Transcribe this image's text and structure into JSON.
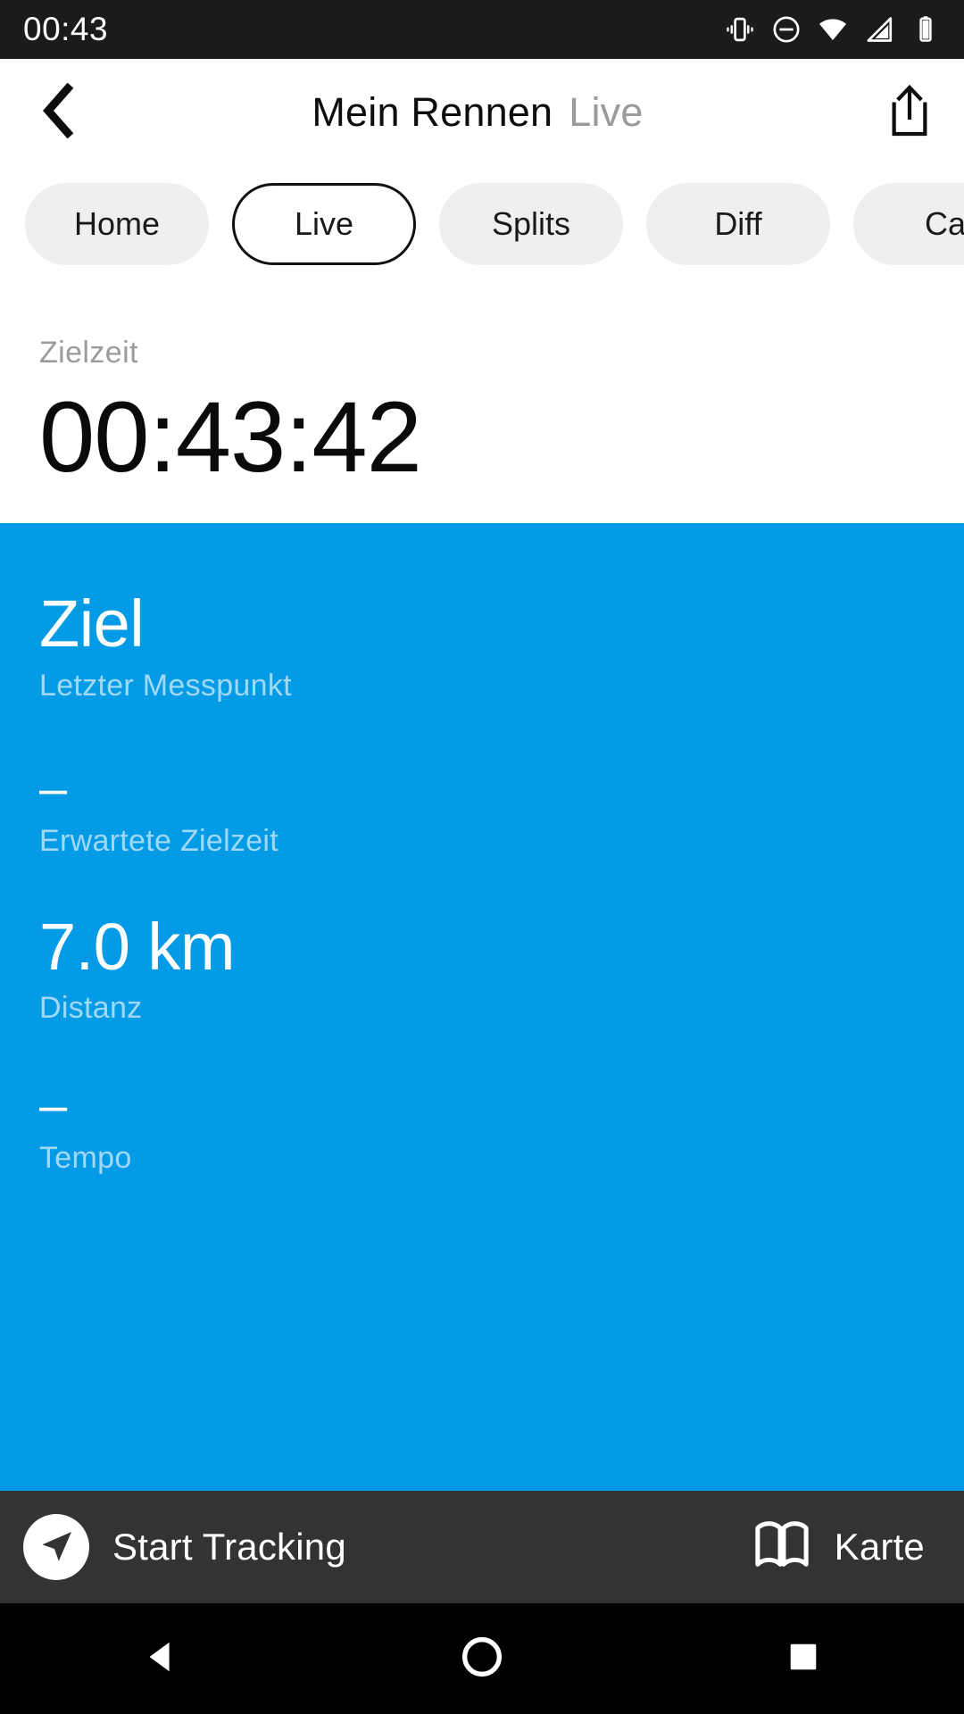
{
  "statusbar": {
    "clock": "00:43",
    "icons": [
      {
        "name": "vibrate-icon"
      },
      {
        "name": "do-not-disturb-icon"
      },
      {
        "name": "wifi-icon"
      },
      {
        "name": "cellular-signal-icon"
      },
      {
        "name": "battery-icon"
      }
    ]
  },
  "header": {
    "back_icon": "chevron-left-icon",
    "title": "Mein Rennen",
    "subtitle": "Live",
    "share_icon": "share-icon"
  },
  "tabs": {
    "items": [
      {
        "label": "Home",
        "selected": false
      },
      {
        "label": "Live",
        "selected": true
      },
      {
        "label": "Splits",
        "selected": false
      },
      {
        "label": "Diff",
        "selected": false
      },
      {
        "label": "Ca",
        "selected": false
      }
    ]
  },
  "summary": {
    "label": "Zielzeit",
    "value": "00:43:42"
  },
  "card": {
    "accent_color": "#039BE5",
    "metrics": [
      {
        "value": "Ziel",
        "label": "Letzter Messpunkt",
        "size": "big"
      },
      {
        "value": "–",
        "label": "Erwartete Zielzeit",
        "size": "dash"
      },
      {
        "value": "7.0 km",
        "label": "Distanz",
        "size": "big"
      },
      {
        "value": "–",
        "label": "Tempo",
        "size": "dash"
      }
    ]
  },
  "toolbar": {
    "tracking_icon": "navigation-arrow-icon",
    "tracking_label": "Start Tracking",
    "map_icon": "map-icon",
    "map_label": "Karte"
  },
  "navbar": {
    "back_icon": "android-back-triangle-icon",
    "home_icon": "android-home-circle-icon",
    "recents_icon": "android-recents-square-icon"
  }
}
